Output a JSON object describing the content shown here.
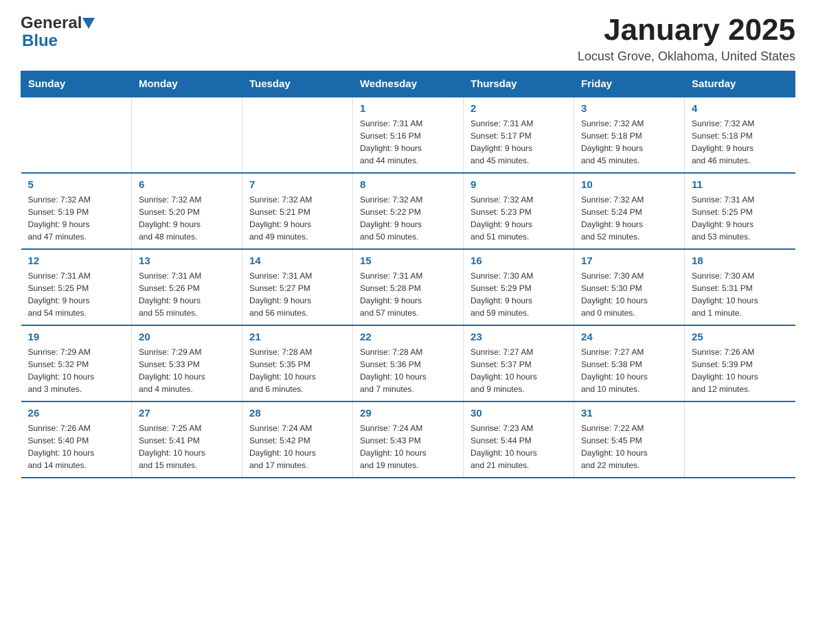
{
  "header": {
    "logo_general": "General",
    "logo_blue": "Blue",
    "title": "January 2025",
    "subtitle": "Locust Grove, Oklahoma, United States"
  },
  "weekdays": [
    "Sunday",
    "Monday",
    "Tuesday",
    "Wednesday",
    "Thursday",
    "Friday",
    "Saturday"
  ],
  "weeks": [
    [
      {
        "day": "",
        "info": ""
      },
      {
        "day": "",
        "info": ""
      },
      {
        "day": "",
        "info": ""
      },
      {
        "day": "1",
        "info": "Sunrise: 7:31 AM\nSunset: 5:16 PM\nDaylight: 9 hours\nand 44 minutes."
      },
      {
        "day": "2",
        "info": "Sunrise: 7:31 AM\nSunset: 5:17 PM\nDaylight: 9 hours\nand 45 minutes."
      },
      {
        "day": "3",
        "info": "Sunrise: 7:32 AM\nSunset: 5:18 PM\nDaylight: 9 hours\nand 45 minutes."
      },
      {
        "day": "4",
        "info": "Sunrise: 7:32 AM\nSunset: 5:18 PM\nDaylight: 9 hours\nand 46 minutes."
      }
    ],
    [
      {
        "day": "5",
        "info": "Sunrise: 7:32 AM\nSunset: 5:19 PM\nDaylight: 9 hours\nand 47 minutes."
      },
      {
        "day": "6",
        "info": "Sunrise: 7:32 AM\nSunset: 5:20 PM\nDaylight: 9 hours\nand 48 minutes."
      },
      {
        "day": "7",
        "info": "Sunrise: 7:32 AM\nSunset: 5:21 PM\nDaylight: 9 hours\nand 49 minutes."
      },
      {
        "day": "8",
        "info": "Sunrise: 7:32 AM\nSunset: 5:22 PM\nDaylight: 9 hours\nand 50 minutes."
      },
      {
        "day": "9",
        "info": "Sunrise: 7:32 AM\nSunset: 5:23 PM\nDaylight: 9 hours\nand 51 minutes."
      },
      {
        "day": "10",
        "info": "Sunrise: 7:32 AM\nSunset: 5:24 PM\nDaylight: 9 hours\nand 52 minutes."
      },
      {
        "day": "11",
        "info": "Sunrise: 7:31 AM\nSunset: 5:25 PM\nDaylight: 9 hours\nand 53 minutes."
      }
    ],
    [
      {
        "day": "12",
        "info": "Sunrise: 7:31 AM\nSunset: 5:25 PM\nDaylight: 9 hours\nand 54 minutes."
      },
      {
        "day": "13",
        "info": "Sunrise: 7:31 AM\nSunset: 5:26 PM\nDaylight: 9 hours\nand 55 minutes."
      },
      {
        "day": "14",
        "info": "Sunrise: 7:31 AM\nSunset: 5:27 PM\nDaylight: 9 hours\nand 56 minutes."
      },
      {
        "day": "15",
        "info": "Sunrise: 7:31 AM\nSunset: 5:28 PM\nDaylight: 9 hours\nand 57 minutes."
      },
      {
        "day": "16",
        "info": "Sunrise: 7:30 AM\nSunset: 5:29 PM\nDaylight: 9 hours\nand 59 minutes."
      },
      {
        "day": "17",
        "info": "Sunrise: 7:30 AM\nSunset: 5:30 PM\nDaylight: 10 hours\nand 0 minutes."
      },
      {
        "day": "18",
        "info": "Sunrise: 7:30 AM\nSunset: 5:31 PM\nDaylight: 10 hours\nand 1 minute."
      }
    ],
    [
      {
        "day": "19",
        "info": "Sunrise: 7:29 AM\nSunset: 5:32 PM\nDaylight: 10 hours\nand 3 minutes."
      },
      {
        "day": "20",
        "info": "Sunrise: 7:29 AM\nSunset: 5:33 PM\nDaylight: 10 hours\nand 4 minutes."
      },
      {
        "day": "21",
        "info": "Sunrise: 7:28 AM\nSunset: 5:35 PM\nDaylight: 10 hours\nand 6 minutes."
      },
      {
        "day": "22",
        "info": "Sunrise: 7:28 AM\nSunset: 5:36 PM\nDaylight: 10 hours\nand 7 minutes."
      },
      {
        "day": "23",
        "info": "Sunrise: 7:27 AM\nSunset: 5:37 PM\nDaylight: 10 hours\nand 9 minutes."
      },
      {
        "day": "24",
        "info": "Sunrise: 7:27 AM\nSunset: 5:38 PM\nDaylight: 10 hours\nand 10 minutes."
      },
      {
        "day": "25",
        "info": "Sunrise: 7:26 AM\nSunset: 5:39 PM\nDaylight: 10 hours\nand 12 minutes."
      }
    ],
    [
      {
        "day": "26",
        "info": "Sunrise: 7:26 AM\nSunset: 5:40 PM\nDaylight: 10 hours\nand 14 minutes."
      },
      {
        "day": "27",
        "info": "Sunrise: 7:25 AM\nSunset: 5:41 PM\nDaylight: 10 hours\nand 15 minutes."
      },
      {
        "day": "28",
        "info": "Sunrise: 7:24 AM\nSunset: 5:42 PM\nDaylight: 10 hours\nand 17 minutes."
      },
      {
        "day": "29",
        "info": "Sunrise: 7:24 AM\nSunset: 5:43 PM\nDaylight: 10 hours\nand 19 minutes."
      },
      {
        "day": "30",
        "info": "Sunrise: 7:23 AM\nSunset: 5:44 PM\nDaylight: 10 hours\nand 21 minutes."
      },
      {
        "day": "31",
        "info": "Sunrise: 7:22 AM\nSunset: 5:45 PM\nDaylight: 10 hours\nand 22 minutes."
      },
      {
        "day": "",
        "info": ""
      }
    ]
  ]
}
